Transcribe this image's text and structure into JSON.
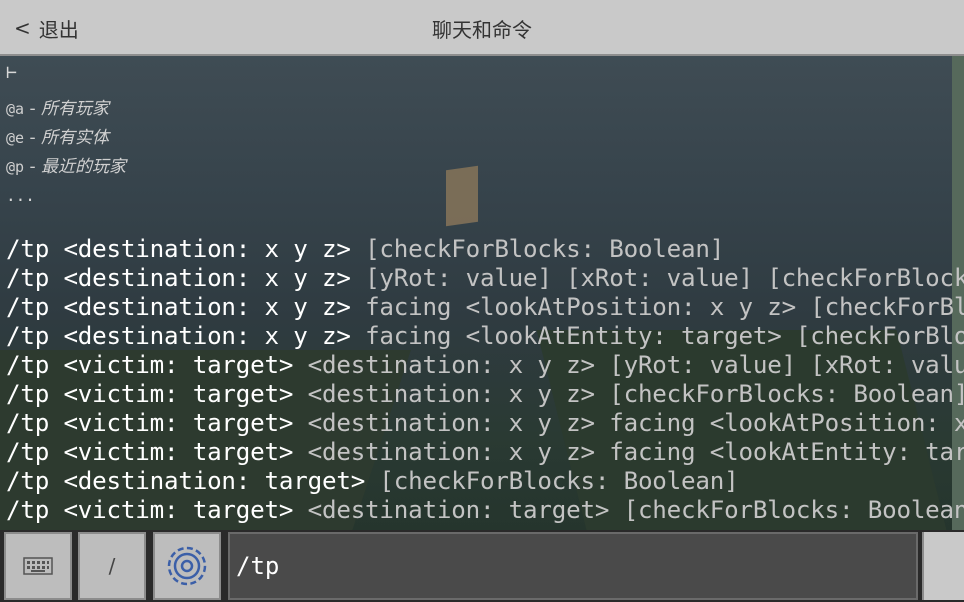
{
  "header": {
    "back_label": "退出",
    "title": "聊天和命令"
  },
  "chat": {
    "caret": "⊢",
    "selectors": [
      {
        "code": "@a",
        "desc": "所有玩家"
      },
      {
        "code": "@e",
        "desc": "所有实体"
      },
      {
        "code": "@p",
        "desc": "最近的玩家"
      }
    ],
    "ellipsis": "...",
    "commands": [
      {
        "prefix": "/tp <destination: x y z>",
        "rest": " [checkForBlocks: Boolean]"
      },
      {
        "prefix": "/tp <destination: x y z>",
        "rest": " [yRot: value] [xRot: value] [checkForBlocks: B"
      },
      {
        "prefix": "/tp <destination: x y z>",
        "rest": " facing <lookAtPosition: x y z> [checkForBlock"
      },
      {
        "prefix": "/tp <destination: x y z>",
        "rest": " facing <lookAtEntity: target> [checkForBlocks"
      },
      {
        "prefix": "/tp <victim: target>",
        "rest": " <destination: x y z> [yRot: value] [xRot: value] [ch"
      },
      {
        "prefix": "/tp <victim: target>",
        "rest": " <destination: x y z> [checkForBlocks: Boolean]"
      },
      {
        "prefix": "/tp <victim: target>",
        "rest": " <destination: x y z> facing <lookAtPosition: x y z>"
      },
      {
        "prefix": "/tp <victim: target>",
        "rest": " <destination: x y z> facing <lookAtEntity: target> I"
      },
      {
        "prefix": "/tp <destination: target>",
        "rest": " [checkForBlocks: Boolean]"
      },
      {
        "prefix": "/tp <victim: target>",
        "rest": " <destination: target> [checkForBlocks: Boolean]"
      }
    ]
  },
  "input": {
    "keyboard_icon": "keyboard-icon",
    "slash_label": "/",
    "settings_icon": "gear-icon",
    "value": "/tp"
  },
  "colors": {
    "topbar": "#c9c9c9",
    "command_text": "#ffffff",
    "parameter_text": "#c3c3c3"
  }
}
